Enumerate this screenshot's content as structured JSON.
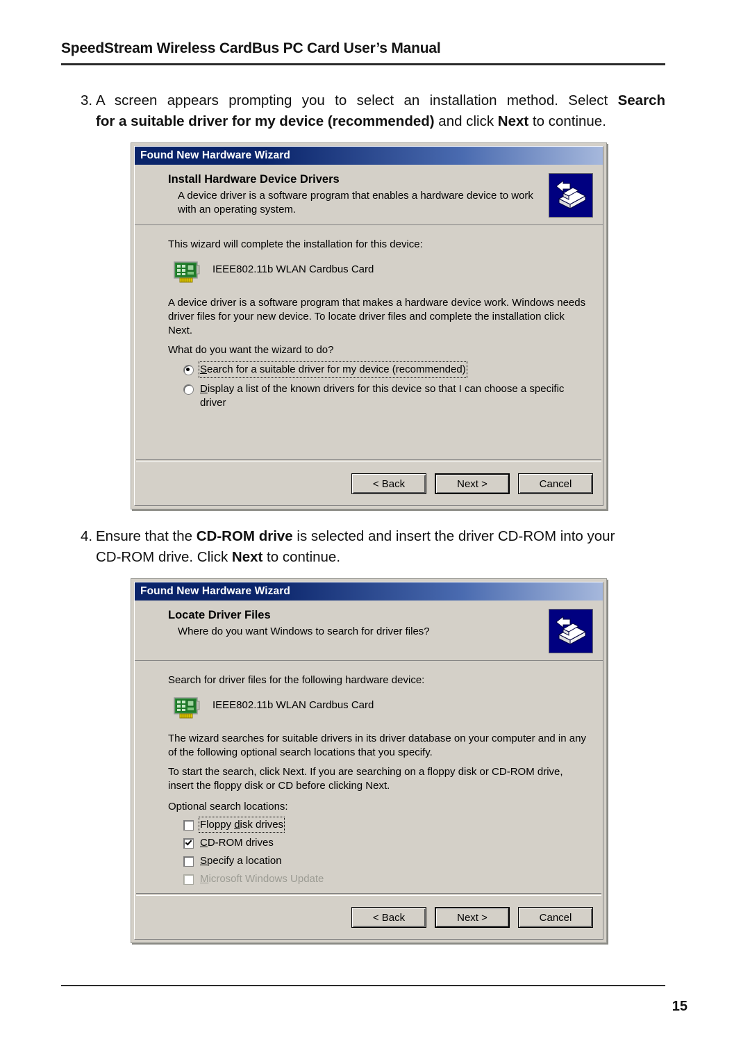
{
  "document": {
    "header_title": "SpeedStream Wireless CardBus PC Card User’s Manual",
    "page_number": "15"
  },
  "steps": [
    {
      "number": "3.",
      "line1_a": "A screen appears prompting you to select an installation method. Select ",
      "line1_b": "Search",
      "line2_a": "for a suitable driver for my device (recommended)",
      "line2_b": " and click ",
      "line2_c": "Next",
      "line2_d": " to continue."
    },
    {
      "number": "4.",
      "line1_a": "Ensure that the ",
      "line1_b": "CD-ROM drive",
      "line1_c": " is selected and insert the driver CD-ROM into your",
      "line2_a": "CD-ROM drive. Click ",
      "line2_b": "Next",
      "line2_c": " to continue."
    }
  ],
  "wizard1": {
    "titlebar": "Found New Hardware Wizard",
    "banner_heading": "Install Hardware Device Drivers",
    "banner_subtext": "A device driver is a software program that enables a hardware device to work with an operating system.",
    "intro": "This wizard will complete the installation for this device:",
    "device_name": "IEEE802.11b WLAN Cardbus Card",
    "explanation": "A device driver is a software program that makes a hardware device work. Windows needs driver files for your new device. To locate driver files and complete the installation click Next.",
    "question": "What do you want the wizard to do?",
    "options": [
      {
        "accel": "S",
        "rest": "earch for a suitable driver for my device (recommended)",
        "checked": true,
        "focused": true
      },
      {
        "accel": "D",
        "rest": "isplay a list of the known drivers for this device so that I can choose a specific driver",
        "checked": false,
        "focused": false
      }
    ],
    "buttons": {
      "back": "< Back",
      "back_accel": "B",
      "next": "Next >",
      "next_accel": "N",
      "cancel": "Cancel"
    }
  },
  "wizard2": {
    "titlebar": "Found New Hardware Wizard",
    "banner_heading": "Locate Driver Files",
    "banner_subtext": "Where do you want Windows to search for driver files?",
    "intro": "Search for driver files for the following hardware device:",
    "device_name": "IEEE802.11b WLAN Cardbus Card",
    "paragraph1": "The wizard searches for suitable drivers in its driver database on your computer and in any of the following optional search locations that you specify.",
    "paragraph2": "To start the search, click Next. If you are searching on a floppy disk or CD-ROM drive, insert the floppy disk or CD before clicking Next.",
    "optional_label": "Optional search locations:",
    "checkboxes": [
      {
        "accel_pre": "Floppy ",
        "accel": "d",
        "rest": "isk drives",
        "checked": false,
        "disabled": false,
        "focused": true
      },
      {
        "accel_pre": "",
        "accel": "C",
        "rest": "D-ROM drives",
        "checked": true,
        "disabled": false,
        "focused": false
      },
      {
        "accel_pre": "",
        "accel": "S",
        "rest": "pecify a location",
        "checked": false,
        "disabled": false,
        "focused": false
      },
      {
        "accel_pre": "",
        "accel": "M",
        "rest": "icrosoft Windows Update",
        "checked": false,
        "disabled": true,
        "focused": false
      }
    ],
    "buttons": {
      "back": "< Back",
      "back_accel": "B",
      "next": "Next >",
      "next_accel": "N",
      "cancel": "Cancel"
    }
  },
  "icons": {
    "banner": "driver-install-icon",
    "device": "network-card-icon"
  },
  "colors": {
    "titlebar_start": "#0a246a",
    "titlebar_end": "#a6b8dc",
    "dialog_face": "#d4d0c8",
    "icon_bg": "#000080",
    "card_green": "#2f8a2f"
  }
}
